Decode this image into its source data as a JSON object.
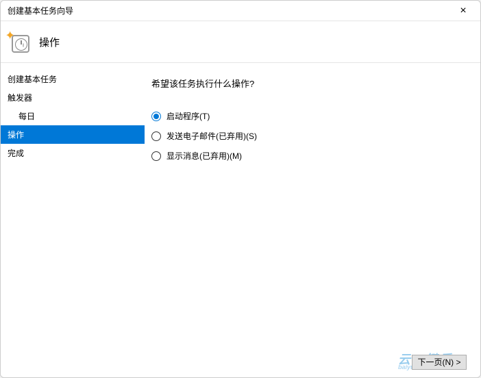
{
  "window": {
    "title": "创建基本任务向导"
  },
  "header": {
    "title": "操作"
  },
  "sidebar": {
    "items": [
      {
        "label": "创建基本任务",
        "selected": false,
        "indent": false
      },
      {
        "label": "触发器",
        "selected": false,
        "indent": false
      },
      {
        "label": "每日",
        "selected": false,
        "indent": true
      },
      {
        "label": "操作",
        "selected": true,
        "indent": false
      },
      {
        "label": "完成",
        "selected": false,
        "indent": false
      }
    ]
  },
  "content": {
    "prompt": "希望该任务执行什么操作?",
    "options": [
      {
        "label": "启动程序(T)",
        "checked": true
      },
      {
        "label": "发送电子邮件(已弃用)(S)",
        "checked": false
      },
      {
        "label": "显示消息(已弃用)(M)",
        "checked": false
      }
    ]
  },
  "footer": {
    "next_label": "下一页(N) >"
  },
  "watermark": {
    "main": "云一键重",
    "sub": "baiyunxi"
  }
}
